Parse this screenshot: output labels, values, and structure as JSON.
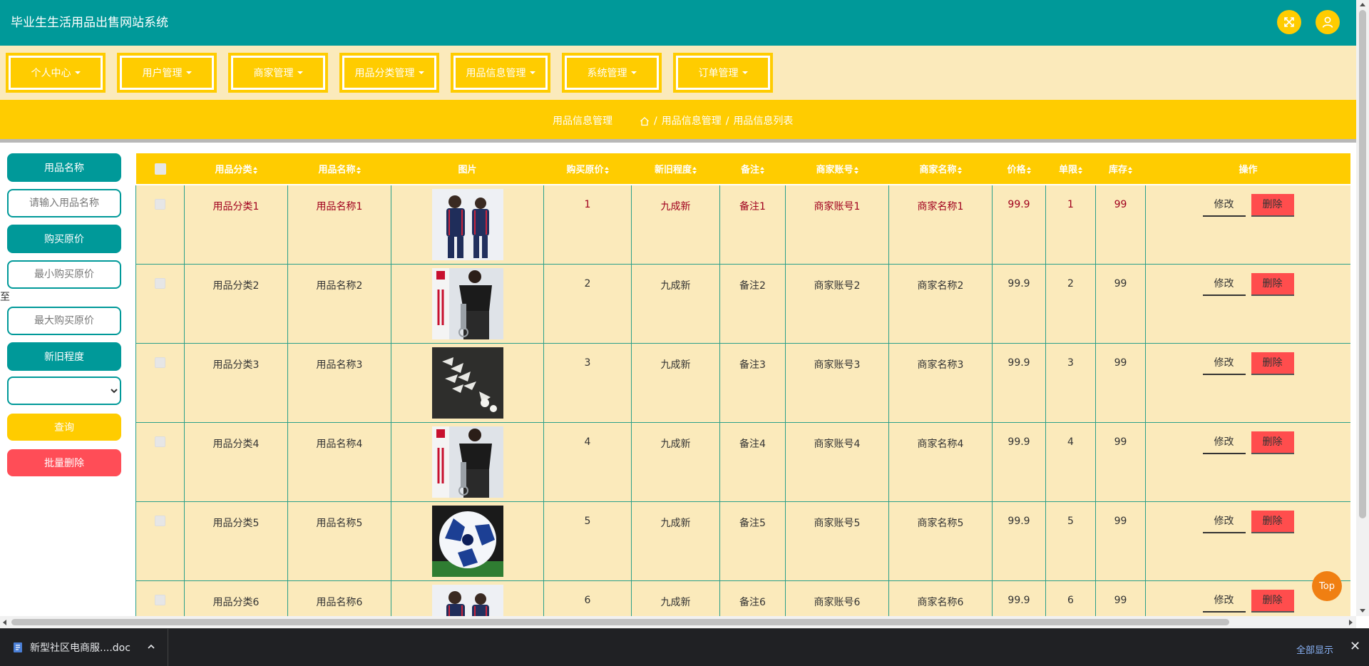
{
  "app": {
    "title": "毕业生生活用品出售网站系统"
  },
  "menu": [
    {
      "label": "个人中心"
    },
    {
      "label": "用户管理"
    },
    {
      "label": "商家管理"
    },
    {
      "label": "用品分类管理"
    },
    {
      "label": "用品信息管理"
    },
    {
      "label": "系统管理"
    },
    {
      "label": "订单管理"
    }
  ],
  "breadcrumb": {
    "title": "用品信息管理",
    "path_1": "用品信息管理",
    "separator": "/",
    "path_2": "用品信息列表"
  },
  "filters": {
    "name_label": "用品名称",
    "name_placeholder": "请输入用品名称",
    "price_label": "购买原价",
    "min_price_placeholder": "最小购买原价",
    "to_label": "至",
    "max_price_placeholder": "最大购买原价",
    "wear_label": "新旧程度",
    "wear_value": "",
    "query_button": "查询",
    "batch_delete_button": "批量删除"
  },
  "table": {
    "columns": [
      "用品分类",
      "用品名称",
      "图片",
      "购买原价",
      "新旧程度",
      "备注",
      "商家账号",
      "商家名称",
      "价格",
      "单限",
      "库存",
      "操作"
    ],
    "edit_label": "修改",
    "delete_label": "删除",
    "rows": [
      {
        "category": "用品分类1",
        "name": "用品名称1",
        "image": "tracksuit-couple",
        "original_price": "1",
        "condition": "九成新",
        "note": "备注1",
        "merchant_account": "商家账号1",
        "merchant_name": "商家名称1",
        "price": "99.9",
        "limit": "1",
        "stock": "99"
      },
      {
        "category": "用品分类2",
        "name": "用品名称2",
        "image": "fitness-trainer",
        "original_price": "2",
        "condition": "九成新",
        "note": "备注2",
        "merchant_account": "商家账号2",
        "merchant_name": "商家名称2",
        "price": "99.9",
        "limit": "2",
        "stock": "99"
      },
      {
        "category": "用品分类3",
        "name": "用品名称3",
        "image": "badminton-shuttlecocks",
        "original_price": "3",
        "condition": "九成新",
        "note": "备注3",
        "merchant_account": "商家账号3",
        "merchant_name": "商家名称3",
        "price": "99.9",
        "limit": "3",
        "stock": "99"
      },
      {
        "category": "用品分类4",
        "name": "用品名称4",
        "image": "fitness-trainer",
        "original_price": "4",
        "condition": "九成新",
        "note": "备注4",
        "merchant_account": "商家账号4",
        "merchant_name": "商家名称4",
        "price": "99.9",
        "limit": "4",
        "stock": "99"
      },
      {
        "category": "用品分类5",
        "name": "用品名称5",
        "image": "soccer-ball",
        "original_price": "5",
        "condition": "九成新",
        "note": "备注5",
        "merchant_account": "商家账号5",
        "merchant_name": "商家名称5",
        "price": "99.9",
        "limit": "5",
        "stock": "99"
      },
      {
        "category": "用品分类6",
        "name": "用品名称6",
        "image": "tracksuit-couple",
        "original_price": "6",
        "condition": "九成新",
        "note": "备注6",
        "merchant_account": "商家账号6",
        "merchant_name": "商家名称6",
        "price": "99.9",
        "limit": "6",
        "stock": "99"
      }
    ]
  },
  "top_button": "Top",
  "downloads": {
    "filename": "新型社区电商服....doc",
    "show_all": "全部显示"
  },
  "colors": {
    "header": "#009999",
    "accent_yellow": "#ffcc00",
    "cream": "#fbeabb",
    "danger": "#ff4d4d"
  }
}
